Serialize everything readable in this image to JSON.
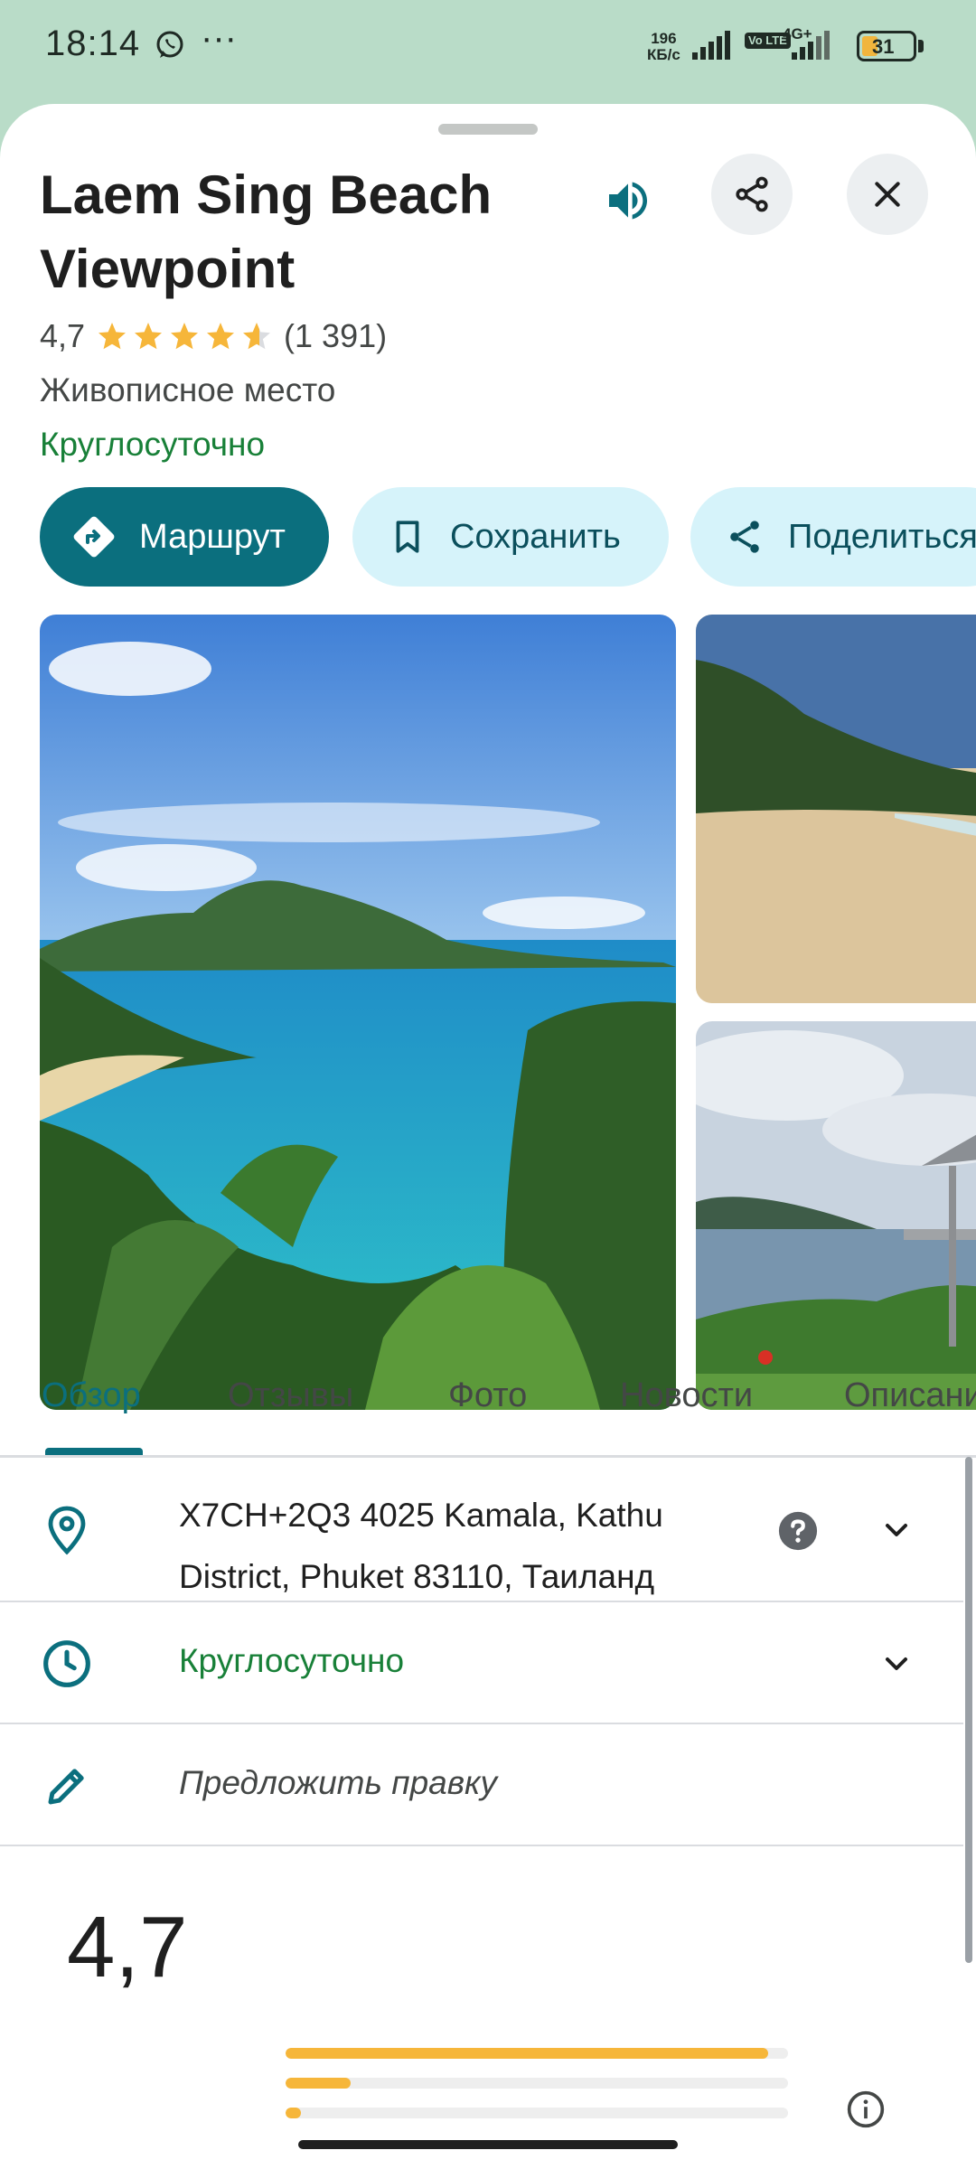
{
  "status_bar": {
    "time": "18:14",
    "more": "···",
    "speed_value": "196",
    "speed_unit": "КБ/с",
    "volte": "Vo LTE",
    "network": "4G+",
    "battery": "31",
    "battery_percent": 31
  },
  "place": {
    "title": "Laem Sing Beach Viewpoint",
    "rating": "4,7",
    "stars_value": 4.7,
    "reviews_count": "(1 391)",
    "category": "Живописное место",
    "open_status": "Круглосуточно"
  },
  "actions": {
    "route": "Маршрут",
    "save": "Сохранить",
    "share": "Поделиться"
  },
  "tabs": [
    {
      "label": "Обзор",
      "active": true
    },
    {
      "label": "Отзывы"
    },
    {
      "label": "Фото"
    },
    {
      "label": "Новости",
      "has_notification": true
    },
    {
      "label": "Описание"
    }
  ],
  "details": {
    "address_line1": "X7CH+2Q3 4025 Kamala, Kathu",
    "address_line2": "District, Phuket 83110, Таиланд",
    "hours": "Круглосуточно",
    "suggest_edit": "Предложить правку"
  },
  "rating_summary": {
    "value": "4,7",
    "bars": [
      0.96,
      0.13,
      0.03
    ]
  },
  "colors": {
    "accent": "#0b6f7e",
    "open_green": "#188038",
    "star": "#f6b63a",
    "chip_bg": "#d6f3fa",
    "notification": "#d93025"
  },
  "icons": {
    "speaker": "speaker-icon",
    "share": "share-icon",
    "close": "close-icon",
    "directions": "directions-icon",
    "bookmark": "bookmark-icon",
    "location": "location-pin-icon",
    "clock": "clock-icon",
    "pencil": "pencil-icon",
    "help": "help-icon",
    "info": "info-icon"
  }
}
